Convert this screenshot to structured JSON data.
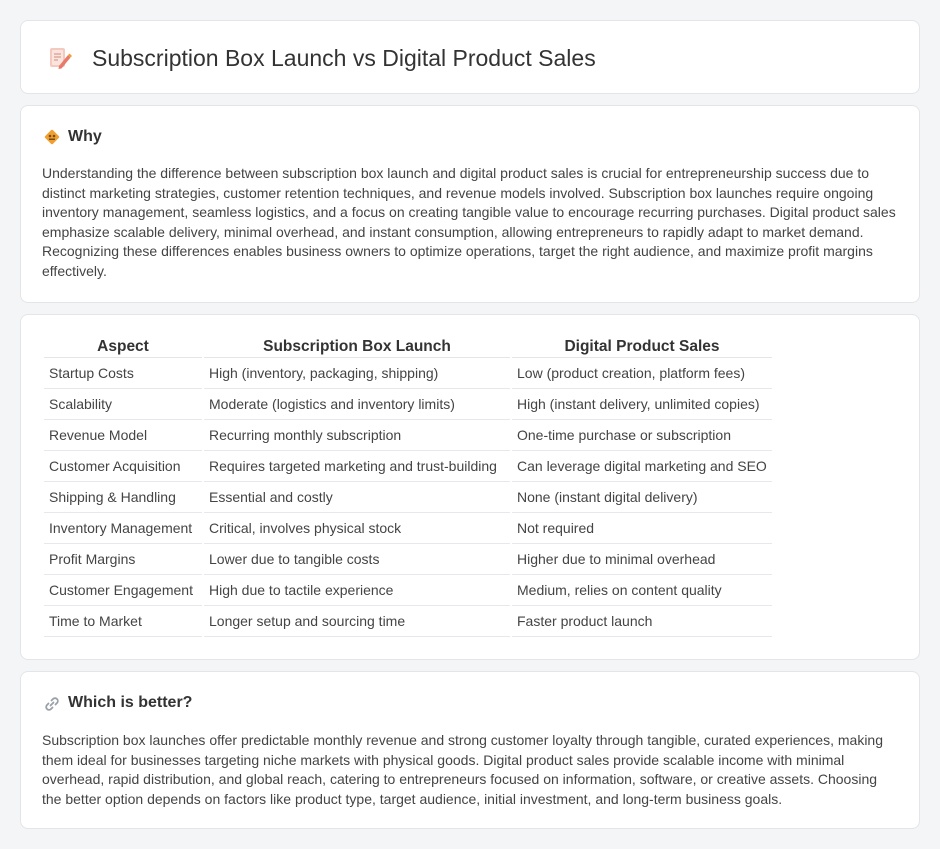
{
  "header": {
    "title": "Subscription Box Launch vs Digital Product Sales",
    "icon": "document-pencil-icon"
  },
  "why": {
    "title": "Why",
    "icon": "diamond-sign-icon",
    "text": "Understanding the difference between subscription box launch and digital product sales is crucial for entrepreneurship success due to distinct marketing strategies, customer retention techniques, and revenue models involved. Subscription box launches require ongoing inventory management, seamless logistics, and a focus on creating tangible value to encourage recurring purchases. Digital product sales emphasize scalable delivery, minimal overhead, and instant consumption, allowing entrepreneurs to rapidly adapt to market demand. Recognizing these differences enables business owners to optimize operations, target the right audience, and maximize profit margins effectively."
  },
  "table": {
    "headers": [
      "Aspect",
      "Subscription Box Launch",
      "Digital Product Sales"
    ],
    "rows": [
      [
        "Startup Costs",
        "High (inventory, packaging, shipping)",
        "Low (product creation, platform fees)"
      ],
      [
        "Scalability",
        "Moderate (logistics and inventory limits)",
        "High (instant delivery, unlimited copies)"
      ],
      [
        "Revenue Model",
        "Recurring monthly subscription",
        "One-time purchase or subscription"
      ],
      [
        "Customer Acquisition",
        "Requires targeted marketing and trust-building",
        "Can leverage digital marketing and SEO"
      ],
      [
        "Shipping & Handling",
        "Essential and costly",
        "None (instant digital delivery)"
      ],
      [
        "Inventory Management",
        "Critical, involves physical stock",
        "Not required"
      ],
      [
        "Profit Margins",
        "Lower due to tangible costs",
        "Higher due to minimal overhead"
      ],
      [
        "Customer Engagement",
        "High due to tactile experience",
        "Medium, relies on content quality"
      ],
      [
        "Time to Market",
        "Longer setup and sourcing time",
        "Faster product launch"
      ]
    ]
  },
  "better": {
    "title": "Which is better?",
    "icon": "link-icon",
    "text": "Subscription box launches offer predictable monthly revenue and strong customer loyalty through tangible, curated experiences, making them ideal for businesses targeting niche markets with physical goods. Digital product sales provide scalable income with minimal overhead, rapid distribution, and global reach, catering to entrepreneurs focused on information, software, or creative assets. Choosing the better option depends on factors like product type, target audience, initial investment, and long-term business goals."
  },
  "colors": {
    "accent_orange": "#f0a030",
    "icon_pink": "#e97a6a",
    "border": "#e3e5e8"
  }
}
